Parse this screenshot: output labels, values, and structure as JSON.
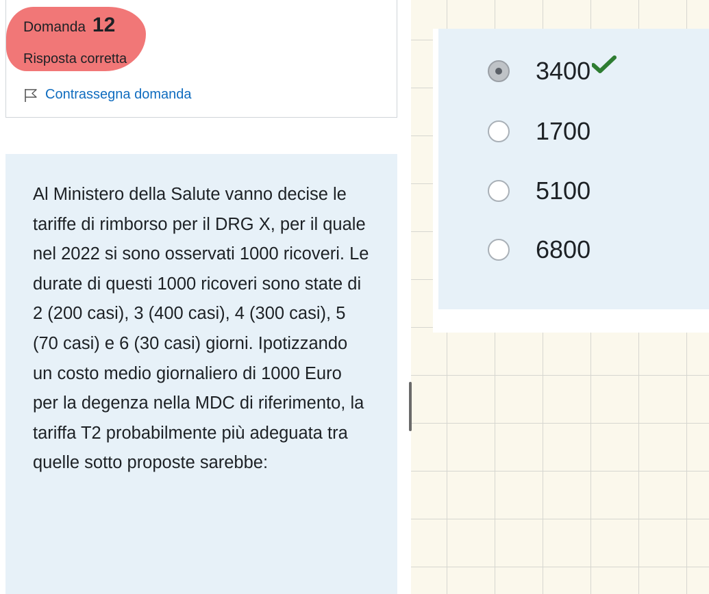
{
  "question_info": {
    "label": "Domanda",
    "number": "12",
    "state": "Risposta corretta",
    "flag_label": "Contrassegna domanda"
  },
  "question": {
    "text": "Al Ministero della Salute vanno decise le tariffe di rimborso per il DRG X, per il quale nel 2022 si sono osservati 1000 ricoveri. Le durate di questi 1000 ricoveri sono state di 2 (200 casi), 3 (400 casi), 4 (300 casi), 5 (70 casi) e 6 (30 casi) giorni. Ipotizzando un costo medio giornaliero di 1000 Euro per la degenza nella MDC di riferimento, la tariffa T2 probabilmente più adeguata tra quelle sotto proposte sarebbe:"
  },
  "answers": {
    "options": [
      {
        "label": "3400",
        "selected": true,
        "correct": true
      },
      {
        "label": "1700",
        "selected": false
      },
      {
        "label": "5100",
        "selected": false
      },
      {
        "label": "6800",
        "selected": false
      }
    ]
  },
  "colors": {
    "highlight": "#f06b6b",
    "link": "#0f6cbf",
    "panel_bg": "#e7f1f8",
    "correct_check": "#2e7d32"
  },
  "icons": {
    "flag": "flag-icon",
    "correct": "check-icon"
  }
}
